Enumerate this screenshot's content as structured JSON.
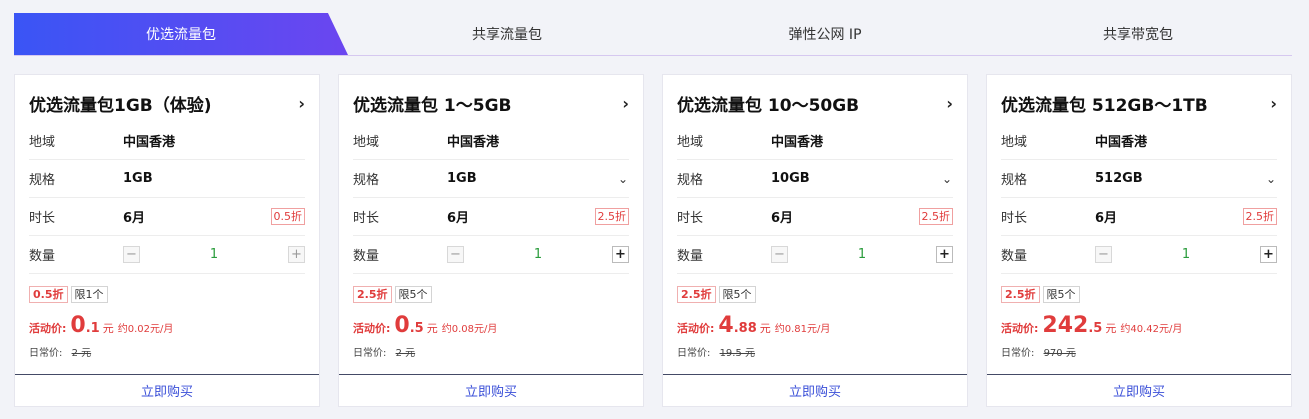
{
  "tabs": [
    {
      "label": "优选流量包",
      "active": true
    },
    {
      "label": "共享流量包",
      "active": false
    },
    {
      "label": "弹性公网 IP",
      "active": false
    },
    {
      "label": "共享带宽包",
      "active": false
    }
  ],
  "labels": {
    "region": "地域",
    "spec": "规格",
    "duration": "时长",
    "quantity": "数量",
    "promo_price": "活动价:",
    "regular_price": "日常价:",
    "currency": "元",
    "buy": "立即购买"
  },
  "icons": {
    "arrow": "chevron-right-icon",
    "dropdown": "chevron-down-icon",
    "minus": "minus-icon",
    "plus": "plus-icon"
  },
  "colors": {
    "accent_start": "#3a55f5",
    "accent_end": "#6b46f0",
    "price_red": "#e03c3c",
    "qty_green": "#2a9c3c",
    "link_blue": "#3a4fd8"
  },
  "cards": [
    {
      "title": "优选流量包1GB（体验)",
      "region": "中国香港",
      "spec": "1GB",
      "duration": "6月",
      "duration_discount": "0.5折",
      "quantity": "1",
      "tag_discount": "0.5折",
      "tag_limit": "限1个",
      "price_int": "0",
      "price_dec": ".1",
      "monthly": "约0.02元/月",
      "original": "2 元"
    },
    {
      "title": "优选流量包 1～5GB",
      "region": "中国香港",
      "spec": "1GB",
      "duration": "6月",
      "duration_discount": "2.5折",
      "quantity": "1",
      "tag_discount": "2.5折",
      "tag_limit": "限5个",
      "price_int": "0",
      "price_dec": ".5",
      "monthly": "约0.08元/月",
      "original": "2 元"
    },
    {
      "title": "优选流量包 10～50GB",
      "region": "中国香港",
      "spec": "10GB",
      "duration": "6月",
      "duration_discount": "2.5折",
      "quantity": "1",
      "tag_discount": "2.5折",
      "tag_limit": "限5个",
      "price_int": "4",
      "price_dec": ".88",
      "monthly": "约0.81元/月",
      "original": "19.5 元"
    },
    {
      "title": "优选流量包 512GB～1TB",
      "region": "中国香港",
      "spec": "512GB",
      "duration": "6月",
      "duration_discount": "2.5折",
      "quantity": "1",
      "tag_discount": "2.5折",
      "tag_limit": "限5个",
      "price_int": "242",
      "price_dec": ".5",
      "monthly": "约40.42元/月",
      "original": "970 元"
    }
  ]
}
